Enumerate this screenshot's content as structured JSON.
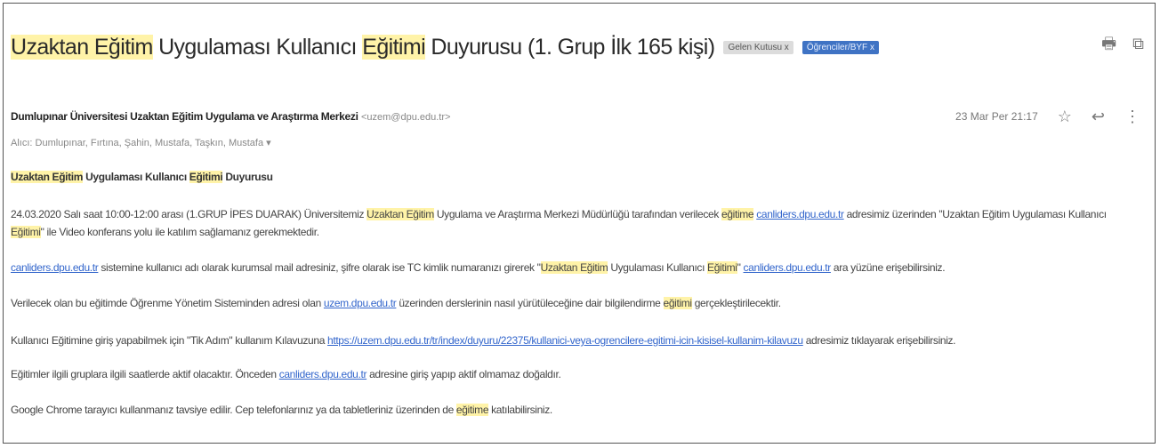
{
  "email": {
    "subject": {
      "highlight_1": "Uzaktan Eğitim",
      "mid_1": " Uygulaması Kullanıcı ",
      "highlight_2": "Eğitimi",
      "rest": " Duyurusu (1. Grup İlk 165 kişi)"
    },
    "labels": [
      {
        "text": "Gelen Kutusu x",
        "color": "#dcdcdc"
      },
      {
        "text": "Öğrenciler/BYF x",
        "color": "#3f73c4"
      }
    ],
    "sender": {
      "name": "Dumlupınar Üniversitesi Uzaktan Eğitim Uygulama ve Araştırma Merkezi",
      "email": "<uzem@dpu.edu.tr>"
    },
    "date": "23 Mar Per 21:17",
    "recipients": "Alıcı: Dumlupınar, Fırtına, Şahin, Mustafa, Taşkın, Mustafa ▾",
    "body": {
      "greeting": {
        "hl1": "Uzaktan Eğitim",
        "mid": " Uygulaması Kullanıcı ",
        "hl2": "Eğitimi",
        "end": " Duyurusu"
      },
      "para1a": {
        "start": "24.03.2020 Salı saat 10:00-12:00 arası (1.GRUP İPES DUARAK) Üniversitemiz ",
        "hl1": "Uzaktan Eğitim",
        "mid": " Uygulama ve Araştırma Merkezi Müdürlüğü tarafından verilecek ",
        "hl2": "eğitime",
        "link": "canliders.dpu.edu.tr",
        "end": " adresimiz üzerinden \"Uzaktan Eğitim Uygulaması Kullanıcı"
      },
      "para1b": {
        "hl": "Eğitimi",
        "end": "\" ile Video konferans yolu ile katılım sağlamanız gerekmektedir."
      },
      "para2": {
        "link": "canliders.dpu.edu.tr",
        "mid": " sistemine kullanıcı adı olarak kurumsal mail adresiniz, şifre olarak ise TC kimlik numaranızı girerek \"",
        "hl1": "Uzaktan Eğitim",
        "mid2": " Uygulaması Kullanıcı ",
        "hl2": "Eğitimi",
        "mid3": "\" ",
        "link2": "canliders.dpu.edu.tr",
        "end": " ara yüzüne erişebilirsiniz."
      },
      "para3": {
        "start": "Verilecek olan bu eğitimde Öğrenme Yönetim Sisteminden adresi olan ",
        "link": "uzem.dpu.edu.tr",
        "mid": " üzerinden derslerinin nasıl yürütüleceğine dair bilgilendirme ",
        "hl": "eğitimi",
        "end": " gerçekleştirilecektir."
      },
      "para4": {
        "start": "Kullanıcı Eğitimine giriş yapabilmek için \"Tik Adım\" kullanım Kılavuzuna ",
        "link": "https://uzem.dpu.edu.tr/tr/index/duyuru/22375/kullanici-veya-ogrencilere-egitimi-icin-kisisel-kullanim-kilavuzu",
        "end": " adresimiz tıklayarak erişebilirsiniz."
      },
      "para5": {
        "start": "Eğitimler ilgili gruplara ilgili saatlerde aktif olacaktır. Önceden ",
        "link": "canliders.dpu.edu.tr",
        "end": " adresine giriş yapıp aktif olmamaz doğaldır."
      },
      "para6": {
        "start": "Google Chrome tarayıcı kullanmanız tavsiye edilir. Cep telefonlarınız ya da tabletleriniz üzerinden de ",
        "hl": "eğitime",
        "end": " katılabilirsiniz."
      }
    }
  },
  "icons": {
    "print": "print-icon",
    "popout": "popout-icon",
    "star": "star-icon",
    "reply": "reply-icon",
    "more": "more-vert-icon"
  }
}
